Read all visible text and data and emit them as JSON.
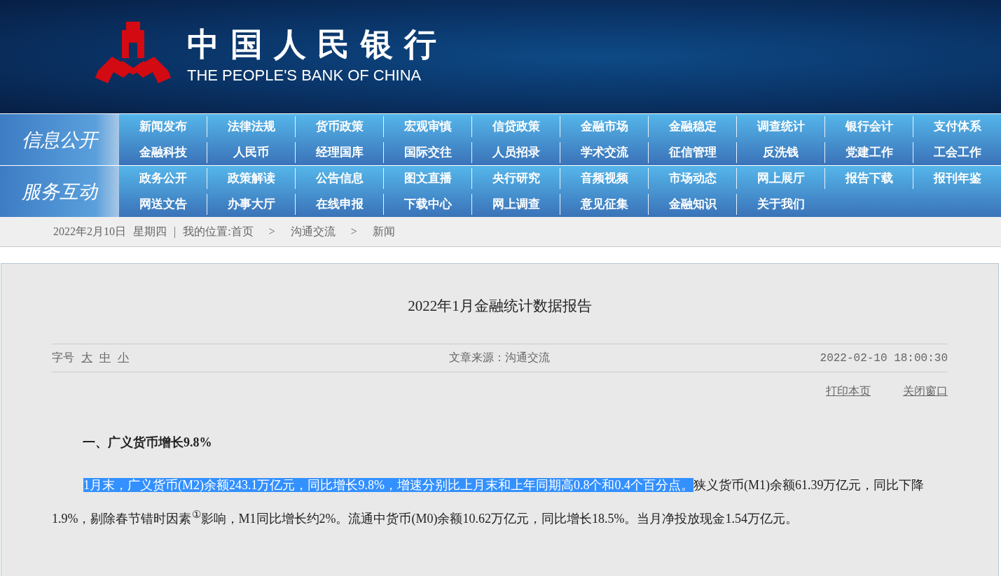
{
  "header": {
    "logo_cn": "中国人民银行",
    "logo_en": "THE PEOPLE'S BANK OF CHINA"
  },
  "nav_sections": [
    {
      "title": "信息公开",
      "rows": [
        [
          "新闻发布",
          "法律法规",
          "货币政策",
          "宏观审慎",
          "信贷政策",
          "金融市场",
          "金融稳定",
          "调查统计",
          "银行会计",
          "支付体系"
        ],
        [
          "金融科技",
          "人民币",
          "经理国库",
          "国际交往",
          "人员招录",
          "学术交流",
          "征信管理",
          "反洗钱",
          "党建工作",
          "工会工作"
        ]
      ]
    },
    {
      "title": "服务互动",
      "rows": [
        [
          "政务公开",
          "政策解读",
          "公告信息",
          "图文直播",
          "央行研究",
          "音频视频",
          "市场动态",
          "网上展厅",
          "报告下载",
          "报刊年鉴"
        ],
        [
          "网送文告",
          "办事大厅",
          "在线申报",
          "下载中心",
          "网上调查",
          "意见征集",
          "金融知识",
          "关于我们"
        ]
      ]
    }
  ],
  "breadcrumb": {
    "date": "2022年2月10日",
    "weekday": "星期四",
    "separator": "|",
    "location_label": "我的位置:",
    "items": [
      "首页",
      "沟通交流",
      "新闻"
    ],
    "arrow": ">"
  },
  "article": {
    "title": "2022年1月金融统计数据报告",
    "font_size_label": "字号",
    "font_sizes": [
      "大",
      "中",
      "小"
    ],
    "source": "文章来源：沟通交流",
    "datetime": "2022-02-10 18:00:30",
    "actions": [
      "打印本页",
      "关闭窗口"
    ],
    "heading": "一、广义货币增长9.8%",
    "paragraph": [
      {
        "text": "1月末，广义货币(M2)余额243.1万亿元，同比增长9.8%，增速分别比上月末和上年同期高0.8个和0.4个百分点。",
        "selected": true
      },
      {
        "text": "狭义货币(M1)余额61.39万亿元，同比下降1.9%，剔除春节错时因素$^{①}$影响，M1同比增长约2%。流通中货币(M0)余额10.62万亿元，同比增长18.5%。当月净投放现金1.54万亿元。",
        "selected": false
      }
    ]
  }
}
